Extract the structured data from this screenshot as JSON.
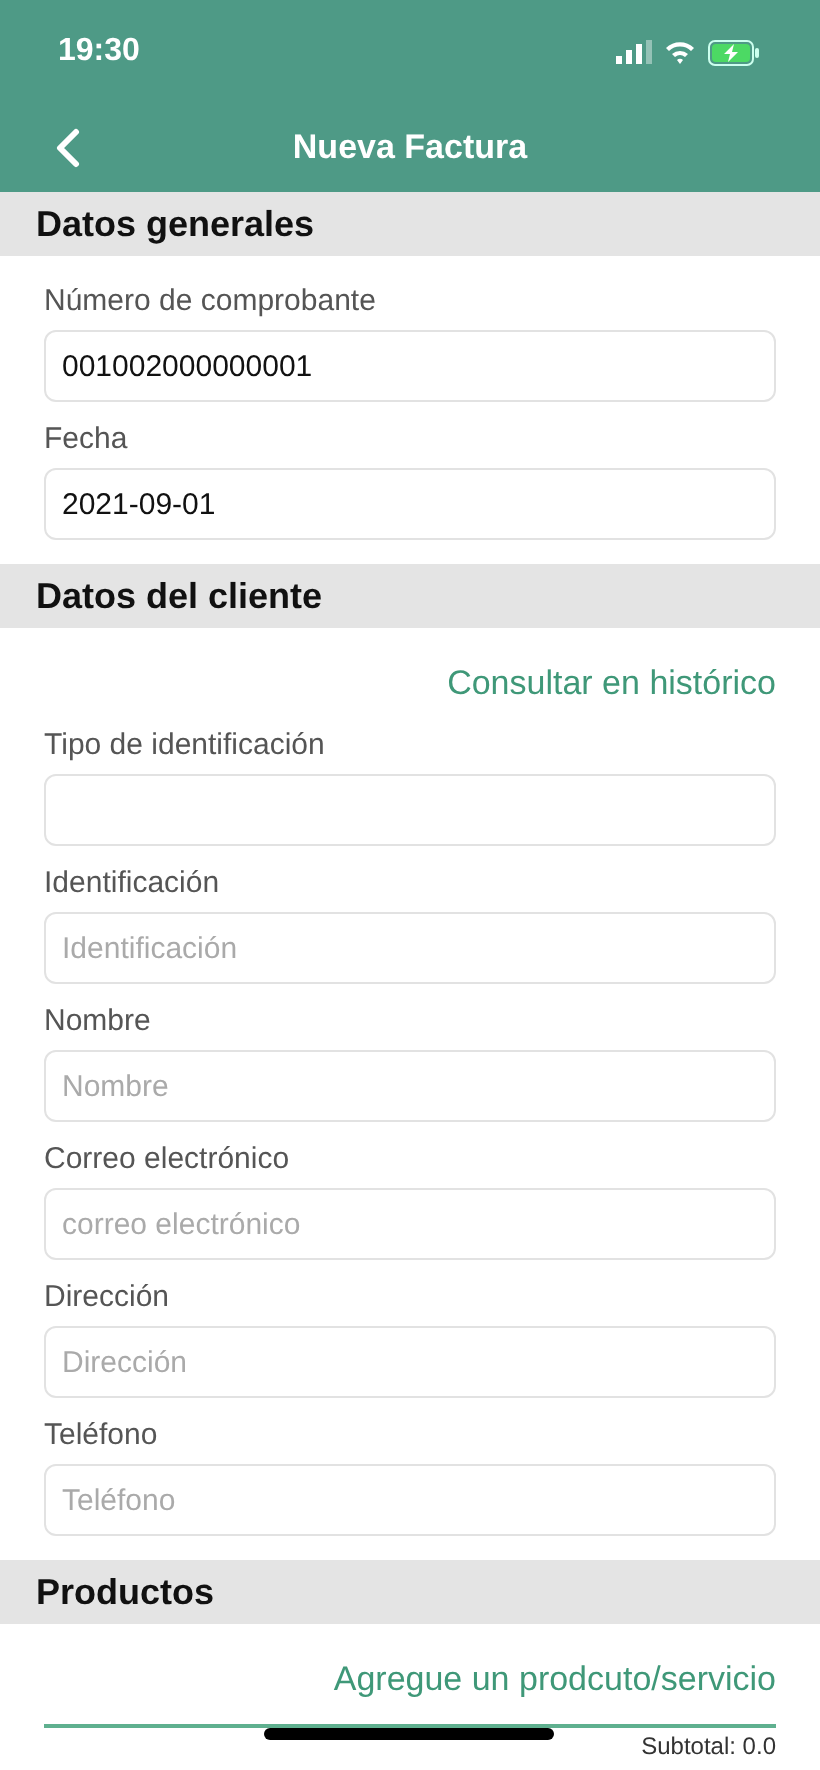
{
  "status_bar": {
    "time": "19:30"
  },
  "nav": {
    "title": "Nueva Factura"
  },
  "sections": [
    {
      "title": "Datos generales",
      "fields": [
        {
          "label": "Número de comprobante",
          "value": "001002000000001"
        },
        {
          "label": "Fecha",
          "value": "2021-09-01"
        }
      ]
    },
    {
      "title": "Datos del cliente",
      "link": "Consultar en histórico",
      "fields": [
        {
          "label": "Tipo de identificación"
        },
        {
          "label": "Identificación",
          "placeholder": "Identificación"
        },
        {
          "label": "Nombre",
          "placeholder": "Nombre"
        },
        {
          "label": "Correo electrónico",
          "placeholder": "correo electrónico"
        },
        {
          "label": "Dirección",
          "placeholder": "Dirección"
        },
        {
          "label": "Teléfono",
          "placeholder": "Teléfono"
        }
      ]
    },
    {
      "title": "Productos",
      "link": "Agregue un prodcuto/servicio",
      "summary": "Subtotal: 0.0"
    }
  ]
}
